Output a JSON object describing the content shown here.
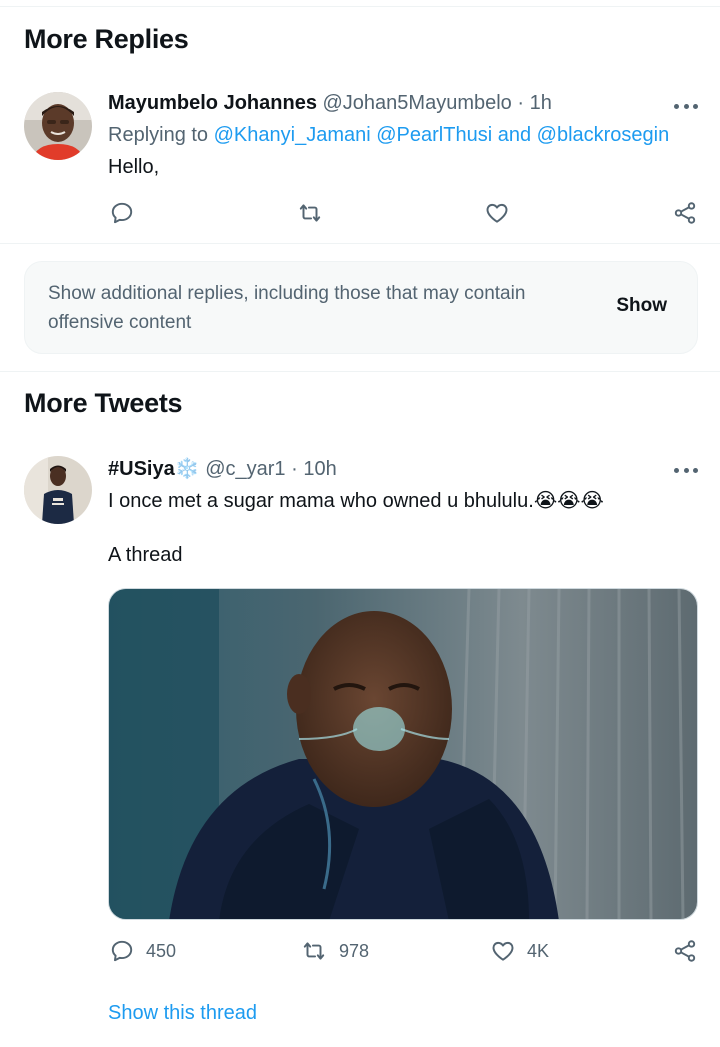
{
  "more_replies": {
    "title": "More Replies",
    "reply": {
      "name": "Mayumbelo Johannes",
      "handle": "@Johan5Mayumbelo",
      "separator": "·",
      "time": "1h",
      "replying_to_label": "Replying to",
      "mention_1": "@Khanyi_Jamani",
      "mention_2": "@PearlThusi",
      "and_label": "and",
      "mention_3": "@blackrosegin",
      "text": "Hello,"
    },
    "notice": {
      "text": "Show additional replies, including those that may contain offensive content",
      "button": "Show"
    }
  },
  "more_tweets": {
    "title": "More Tweets",
    "tweet": {
      "name": "#USiya",
      "name_emoji": "❄️",
      "handle": "@c_yar1",
      "separator": "·",
      "time": "10h",
      "text_line1": "I once met a sugar mama who owned u bhululu.",
      "text_emoji": "😭😭😭",
      "text_line2": "A thread",
      "reply_count": "450",
      "retweet_count": "978",
      "like_count": "4K",
      "show_thread": "Show this thread"
    }
  },
  "icons": {
    "reply": "reply-icon",
    "retweet": "retweet-icon",
    "like": "heart-icon",
    "share": "share-icon",
    "more": "more-options-icon"
  },
  "colors": {
    "link": "#1d9bf0",
    "secondary_text": "#536471",
    "primary_text": "#0f1419",
    "notice_bg": "#f7f9f9"
  }
}
